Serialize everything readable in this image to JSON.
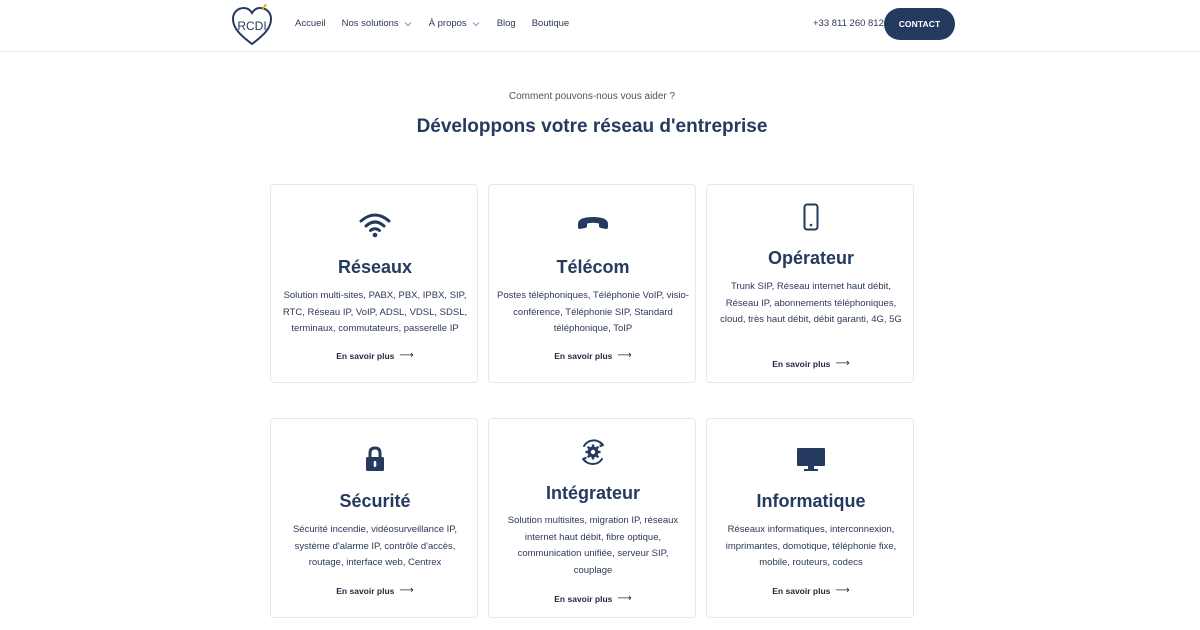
{
  "header": {
    "logo_text": "RCDI",
    "nav": [
      {
        "label": "Accueil",
        "dropdown": false
      },
      {
        "label": "Nos solutions",
        "dropdown": true
      },
      {
        "label": "À propos",
        "dropdown": true
      },
      {
        "label": "Blog",
        "dropdown": false
      },
      {
        "label": "Boutique",
        "dropdown": false
      }
    ],
    "phone": "+33 811 260 812",
    "contact_label": "CONTACT"
  },
  "section": {
    "kicker": "Comment pouvons-nous vous aider ?",
    "title": "Développons votre réseau d'entreprise"
  },
  "cards": [
    {
      "icon": "wifi-icon",
      "title": "Réseaux",
      "description": "Solution multi-sites, PABX, PBX, IPBX, SIP, RTC, Réseau IP, VoIP, ADSL, VDSL, SDSL, terminaux, commutateurs, passerelle IP",
      "more": "En savoir plus"
    },
    {
      "icon": "phone-icon",
      "title": "Télécom",
      "description": "Postes téléphoniques, Téléphonie VoIP, visio-conférence, Téléphonie SIP, Standard téléphonique, ToIP",
      "more": "En savoir plus"
    },
    {
      "icon": "mobile-icon",
      "title": "Opérateur",
      "description": "Trunk SIP, Réseau internet haut débit, Réseau IP, abonnements téléphoniques, cloud, très haut débit, débit garanti, 4G, 5G",
      "more": "En savoir plus"
    },
    {
      "icon": "lock-icon",
      "title": "Sécurité",
      "description": "Sécurité incendie, vidéosurveillance IP, système d'alarme IP, contrôle d'accès, routage, interface web, Centrex",
      "more": "En savoir plus"
    },
    {
      "icon": "gear-sync-icon",
      "title": "Intégrateur",
      "description": "Solution multisites, migration IP, réseaux internet haut débit, fibre optique, communication unifiée, serveur SIP, couplage",
      "more": "En savoir plus"
    },
    {
      "icon": "monitor-icon",
      "title": "Informatique",
      "description": "Réseaux informatiques, interconnexion, imprimantes, domotique, téléphonie fixe, mobile, routeurs, codecs",
      "more": "En savoir plus"
    }
  ],
  "colors": {
    "primary": "#243a5e",
    "text": "#2b3a55",
    "border": "#e7e7e7",
    "logo_accent": "#f5a623"
  }
}
